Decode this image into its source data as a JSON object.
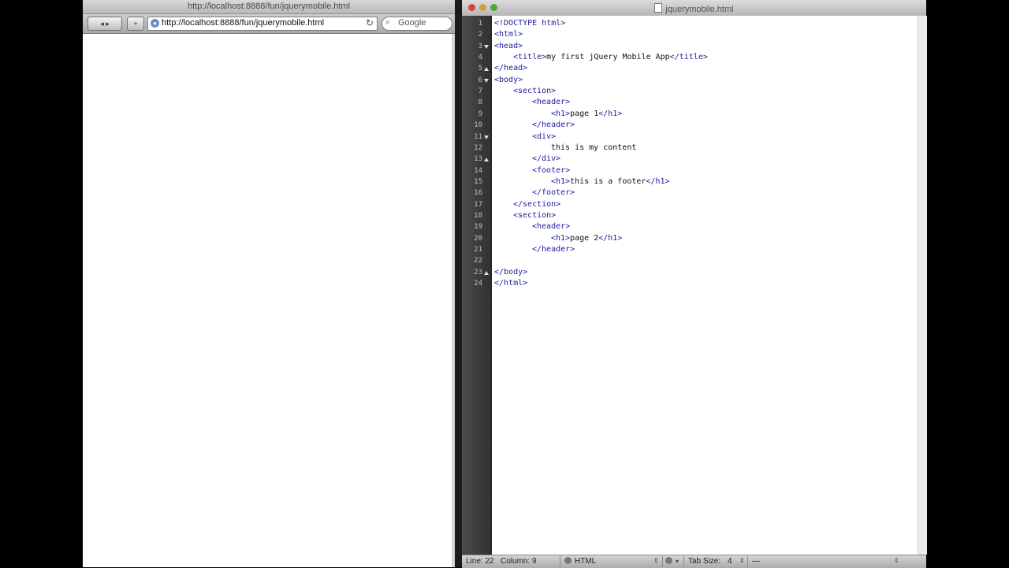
{
  "browser": {
    "title": "http://localhost:8888/fun/jquerymobile.html",
    "url": "http://localhost:8888/fun/jquerymobile.html",
    "search_placeholder": "Google",
    "back_label": "◂ ▸",
    "bookmark_label": "+"
  },
  "editor": {
    "title": "jquerymobile.html",
    "lines": [
      {
        "n": "1",
        "indent": 0,
        "parts": [
          {
            "t": "<!DOCTYPE html>",
            "c": "tag"
          }
        ]
      },
      {
        "n": "2",
        "indent": 0,
        "parts": [
          {
            "t": "<html>",
            "c": "tag"
          }
        ]
      },
      {
        "n": "3",
        "indent": 0,
        "parts": [
          {
            "t": "<head>",
            "c": "tag"
          }
        ]
      },
      {
        "n": "4",
        "indent": 1,
        "parts": [
          {
            "t": "<title>",
            "c": "tag"
          },
          {
            "t": "my first jQuery Mobile App",
            "c": "txt"
          },
          {
            "t": "</title>",
            "c": "tag"
          }
        ]
      },
      {
        "n": "5",
        "indent": 0,
        "parts": [
          {
            "t": "</head>",
            "c": "tag"
          }
        ]
      },
      {
        "n": "6",
        "indent": 0,
        "parts": [
          {
            "t": "<body>",
            "c": "tag"
          }
        ]
      },
      {
        "n": "7",
        "indent": 1,
        "parts": [
          {
            "t": "<section>",
            "c": "tag"
          }
        ]
      },
      {
        "n": "8",
        "indent": 2,
        "parts": [
          {
            "t": "<header>",
            "c": "tag"
          }
        ]
      },
      {
        "n": "9",
        "indent": 3,
        "parts": [
          {
            "t": "<h1>",
            "c": "tag"
          },
          {
            "t": "page 1",
            "c": "txt"
          },
          {
            "t": "</h1>",
            "c": "tag"
          }
        ]
      },
      {
        "n": "10",
        "indent": 2,
        "parts": [
          {
            "t": "</header>",
            "c": "tag"
          }
        ]
      },
      {
        "n": "11",
        "indent": 2,
        "parts": [
          {
            "t": "<div>",
            "c": "tag"
          }
        ]
      },
      {
        "n": "12",
        "indent": 3,
        "parts": [
          {
            "t": "this is my content",
            "c": "txt"
          }
        ]
      },
      {
        "n": "13",
        "indent": 2,
        "parts": [
          {
            "t": "</div>",
            "c": "tag"
          }
        ]
      },
      {
        "n": "14",
        "indent": 2,
        "parts": [
          {
            "t": "<footer>",
            "c": "tag"
          }
        ]
      },
      {
        "n": "15",
        "indent": 3,
        "parts": [
          {
            "t": "<h1>",
            "c": "tag"
          },
          {
            "t": "this is a footer",
            "c": "txt"
          },
          {
            "t": "</h1>",
            "c": "tag"
          }
        ]
      },
      {
        "n": "16",
        "indent": 2,
        "parts": [
          {
            "t": "</footer>",
            "c": "tag"
          }
        ]
      },
      {
        "n": "17",
        "indent": 1,
        "parts": [
          {
            "t": "</section>",
            "c": "tag"
          }
        ]
      },
      {
        "n": "18",
        "indent": 1,
        "parts": [
          {
            "t": "<section>",
            "c": "tag"
          }
        ]
      },
      {
        "n": "19",
        "indent": 2,
        "parts": [
          {
            "t": "<header>",
            "c": "tag"
          }
        ]
      },
      {
        "n": "20",
        "indent": 3,
        "parts": [
          {
            "t": "<h1>",
            "c": "tag"
          },
          {
            "t": "page 2",
            "c": "txt"
          },
          {
            "t": "</h1>",
            "c": "tag"
          }
        ]
      },
      {
        "n": "21",
        "indent": 2,
        "parts": [
          {
            "t": "</header>",
            "c": "tag"
          }
        ]
      },
      {
        "n": "22",
        "indent": 0,
        "parts": []
      },
      {
        "n": "23",
        "indent": 0,
        "parts": [
          {
            "t": "</body>",
            "c": "tag"
          }
        ]
      },
      {
        "n": "24",
        "indent": 0,
        "parts": [
          {
            "t": "</html>",
            "c": "tag"
          }
        ]
      }
    ],
    "folds": [
      {
        "line": 3,
        "type": "open"
      },
      {
        "line": 5,
        "type": "close"
      },
      {
        "line": 6,
        "type": "open"
      },
      {
        "line": 11,
        "type": "open"
      },
      {
        "line": 13,
        "type": "close"
      },
      {
        "line": 23,
        "type": "close"
      }
    ]
  },
  "status": {
    "line": "Line: 22",
    "column": "Column: 9",
    "language": "HTML",
    "tab_size_label": "Tab Size:",
    "tab_size": "4",
    "symbol": "—"
  },
  "colors": {
    "tag": "#1c1c9c",
    "text": "#111111",
    "gutter": "#3c3c3c"
  }
}
